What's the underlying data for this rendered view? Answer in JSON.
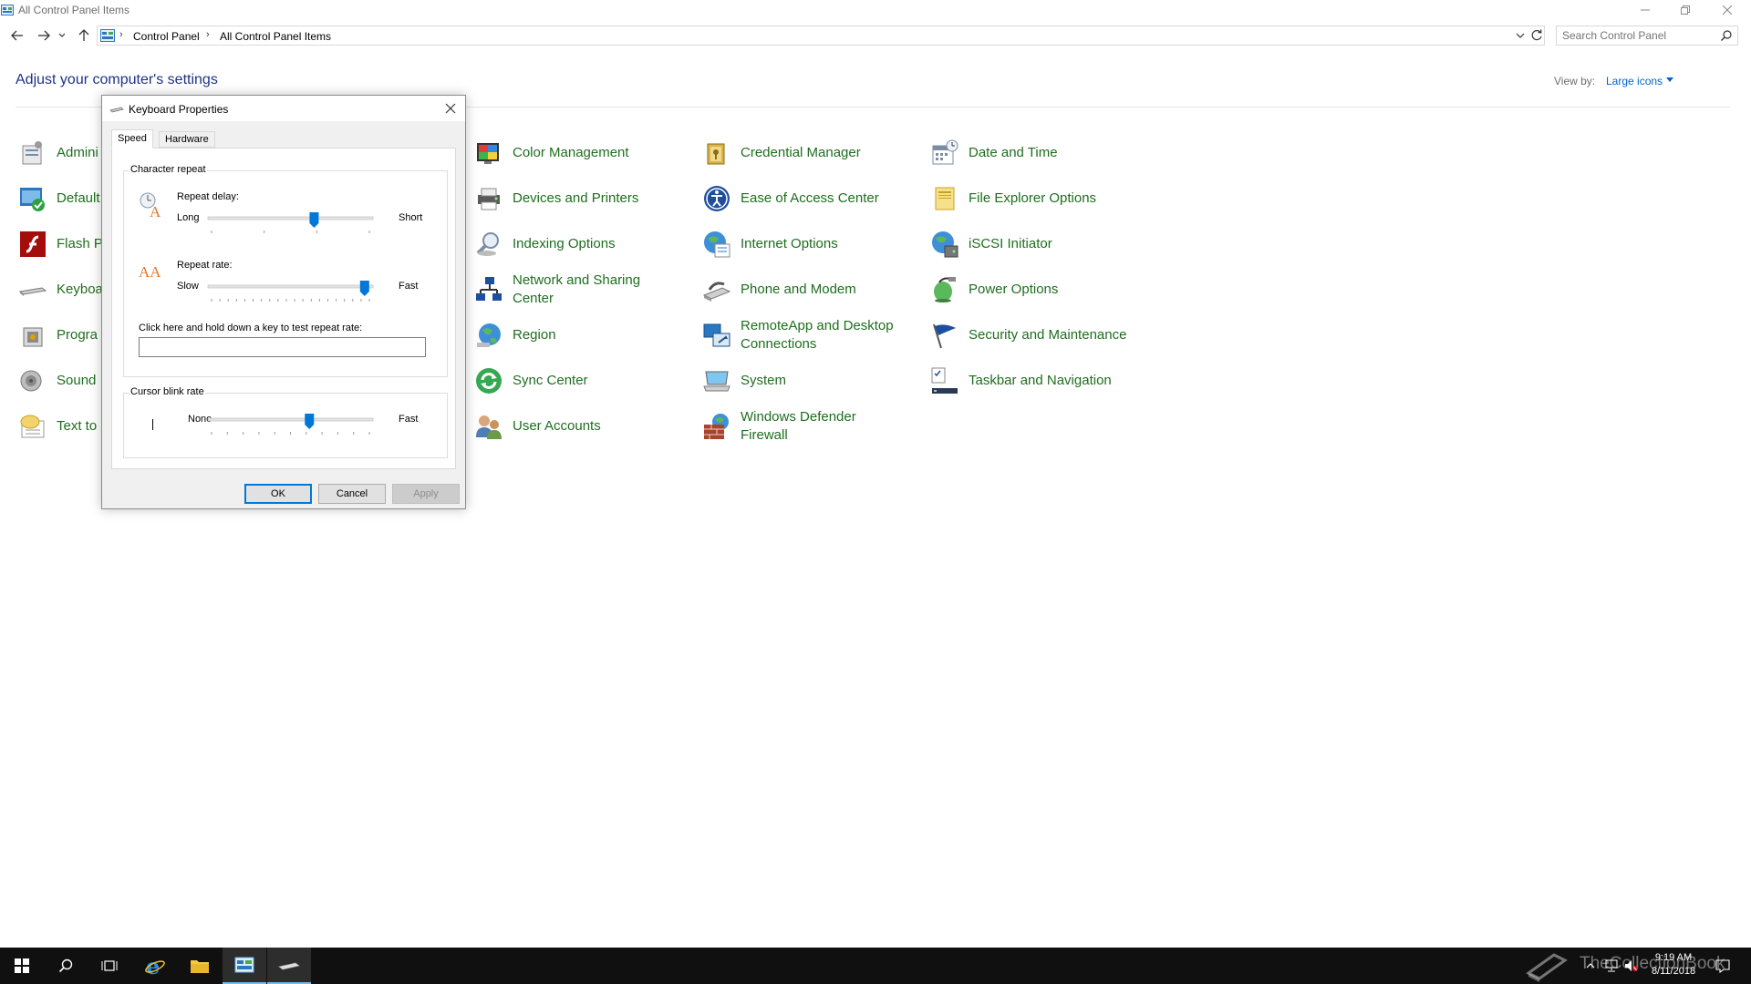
{
  "window": {
    "title": "All Control Panel Items"
  },
  "navigation": {
    "breadcrumbs": [
      "Control Panel",
      "All Control Panel Items"
    ],
    "search_placeholder": "Search Control Panel"
  },
  "header": {
    "heading": "Adjust your computer's settings",
    "view_by_label": "View by:",
    "view_by_value": "Large icons"
  },
  "items": {
    "col1": [
      {
        "label": "Admini",
        "icon": "administrative-tools-icon"
      },
      {
        "label": "Default",
        "icon": "default-programs-icon"
      },
      {
        "label": "Flash P",
        "icon": "flash-player-icon"
      },
      {
        "label": "Keyboa",
        "icon": "keyboard-icon"
      },
      {
        "label": "Progra",
        "icon": "programs-features-icon"
      },
      {
        "label": "Sound",
        "icon": "sound-icon"
      },
      {
        "label": "Text to",
        "icon": "text-to-speech-icon"
      }
    ],
    "col2": [
      {
        "label": "Color Management",
        "icon": "color-management-icon"
      },
      {
        "label": "Devices and Printers",
        "icon": "devices-printers-icon"
      },
      {
        "label": "Indexing Options",
        "icon": "indexing-options-icon"
      },
      {
        "label": "Network and Sharing Center",
        "icon": "network-sharing-icon"
      },
      {
        "label": "Region",
        "icon": "region-icon"
      },
      {
        "label": "Sync Center",
        "icon": "sync-center-icon"
      },
      {
        "label": "User Accounts",
        "icon": "user-accounts-icon"
      }
    ],
    "col3": [
      {
        "label": "Credential Manager",
        "icon": "credential-manager-icon"
      },
      {
        "label": "Ease of Access Center",
        "icon": "ease-of-access-icon"
      },
      {
        "label": "Internet Options",
        "icon": "internet-options-icon"
      },
      {
        "label": "Phone and Modem",
        "icon": "phone-modem-icon"
      },
      {
        "label": "RemoteApp and Desktop Connections",
        "icon": "remoteapp-icon"
      },
      {
        "label": "System",
        "icon": "system-icon"
      },
      {
        "label": "Windows Defender Firewall",
        "icon": "firewall-icon"
      }
    ],
    "col4": [
      {
        "label": "Date and Time",
        "icon": "date-time-icon"
      },
      {
        "label": "File Explorer Options",
        "icon": "file-explorer-options-icon"
      },
      {
        "label": "iSCSI Initiator",
        "icon": "iscsi-initiator-icon"
      },
      {
        "label": "Power Options",
        "icon": "power-options-icon"
      },
      {
        "label": "Security and Maintenance",
        "icon": "security-maintenance-icon"
      },
      {
        "label": "Taskbar and Navigation",
        "icon": "taskbar-navigation-icon"
      }
    ]
  },
  "dialog": {
    "title": "Keyboard Properties",
    "tabs": [
      "Speed",
      "Hardware"
    ],
    "active_tab": "Speed",
    "character_repeat": {
      "group_label": "Character repeat",
      "repeat_delay": {
        "label": "Repeat delay:",
        "min_label": "Long",
        "max_label": "Short",
        "value_fraction": 0.65
      },
      "repeat_rate": {
        "label": "Repeat rate:",
        "min_label": "Slow",
        "max_label": "Fast",
        "value_fraction": 0.97
      },
      "test_prompt": "Click here and hold down a key to test repeat rate:",
      "test_value": ""
    },
    "cursor_blink": {
      "group_label": "Cursor blink rate",
      "min_label": "None",
      "max_label": "Fast",
      "value_fraction": 0.62
    },
    "buttons": {
      "ok": "OK",
      "cancel": "Cancel",
      "apply": "Apply"
    }
  },
  "taskbar": {
    "apps": [
      "start-icon",
      "search-icon",
      "task-view-icon",
      "internet-explorer-icon",
      "file-explorer-icon",
      "control-panel-icon",
      "keyboard-properties-icon"
    ],
    "clock_time": "9:19 AM",
    "clock_date": "8/11/2018",
    "watermark": "TheCollectionBook"
  },
  "colors": {
    "link_green": "#1e6e1e",
    "heading_blue": "#1e3287",
    "accent": "#0078d7",
    "taskbar": "#101010"
  }
}
